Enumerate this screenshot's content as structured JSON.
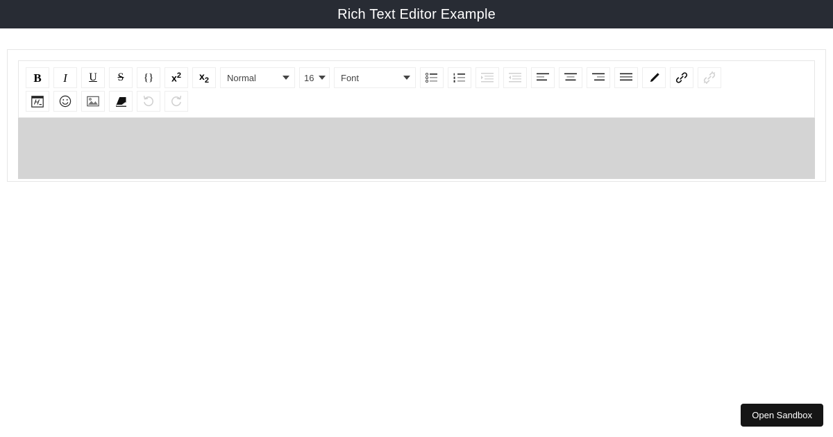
{
  "header": {
    "title": "Rich Text Editor Example",
    "background": "#282c34",
    "text_color": "#ffffff"
  },
  "editor": {
    "toolbar": {
      "rows": [
        {
          "items": [
            {
              "name": "bold-button",
              "icon": "bold-icon",
              "label": "B",
              "disabled": false
            },
            {
              "name": "italic-button",
              "icon": "italic-icon",
              "label": "I",
              "disabled": false
            },
            {
              "name": "underline-button",
              "icon": "underline-icon",
              "label": "U",
              "disabled": false
            },
            {
              "name": "strikethrough-button",
              "icon": "strikethrough-icon",
              "label": "S",
              "disabled": false
            },
            {
              "name": "code-block-button",
              "icon": "code-block-icon",
              "label": "{}",
              "disabled": false
            },
            {
              "name": "superscript-button",
              "icon": "superscript-icon",
              "label": "x2",
              "disabled": false
            },
            {
              "name": "subscript-button",
              "icon": "subscript-icon",
              "label": "x2",
              "disabled": false
            },
            {
              "name": "header-select",
              "icon": "chevron-down-icon",
              "label": "Normal",
              "disabled": false
            },
            {
              "name": "font-size-select",
              "icon": "chevron-down-icon",
              "label": "16",
              "disabled": false
            },
            {
              "name": "font-family-select",
              "icon": "chevron-down-icon",
              "label": "Font",
              "disabled": false
            },
            {
              "name": "bullet-list-button",
              "icon": "bullet-list-icon",
              "label": "",
              "disabled": false
            },
            {
              "name": "ordered-list-button",
              "icon": "ordered-list-icon",
              "label": "",
              "disabled": false
            },
            {
              "name": "indent-button",
              "icon": "indent-icon",
              "label": "",
              "disabled": true
            },
            {
              "name": "outdent-button",
              "icon": "outdent-icon",
              "label": "",
              "disabled": true
            },
            {
              "name": "align-left-button",
              "icon": "align-left-icon",
              "label": "",
              "disabled": false
            },
            {
              "name": "align-center-button",
              "icon": "align-center-icon",
              "label": "",
              "disabled": false
            },
            {
              "name": "align-right-button",
              "icon": "align-right-icon",
              "label": "",
              "disabled": false
            },
            {
              "name": "align-justify-button",
              "icon": "align-justify-icon",
              "label": "",
              "disabled": false
            },
            {
              "name": "pen-button",
              "icon": "pen-icon",
              "label": "",
              "disabled": false
            },
            {
              "name": "link-button",
              "icon": "link-icon",
              "label": "",
              "disabled": false
            },
            {
              "name": "unlink-button",
              "icon": "unlink-icon",
              "label": "",
              "disabled": true
            }
          ]
        },
        {
          "items": [
            {
              "name": "formula-button",
              "icon": "formula-icon",
              "label": "",
              "disabled": false
            },
            {
              "name": "emoji-button",
              "icon": "emoji-icon",
              "label": "",
              "disabled": false
            },
            {
              "name": "image-button",
              "icon": "image-icon",
              "label": "",
              "disabled": false
            },
            {
              "name": "eraser-button",
              "icon": "eraser-icon",
              "label": "",
              "disabled": false
            },
            {
              "name": "undo-button",
              "icon": "undo-icon",
              "label": "",
              "disabled": true
            },
            {
              "name": "redo-button",
              "icon": "redo-icon",
              "label": "",
              "disabled": true
            }
          ]
        }
      ],
      "header_select_value": "Normal",
      "size_select_value": "16",
      "font_select_value": "Font"
    },
    "content": {
      "text": "",
      "background": "#d4d4d4"
    }
  },
  "sandbox": {
    "button_label": "Open Sandbox",
    "background": "#151515",
    "text_color": "#ffffff"
  }
}
